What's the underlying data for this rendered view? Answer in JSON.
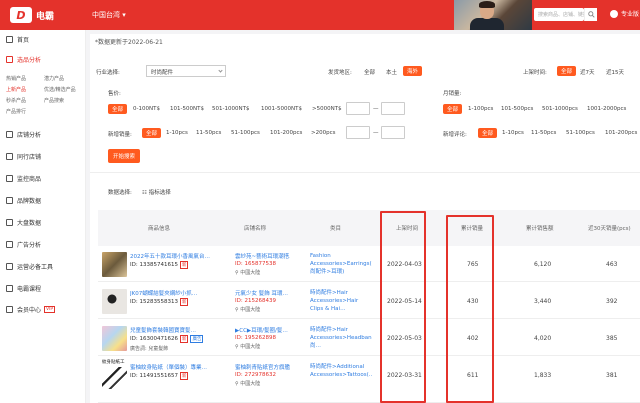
{
  "header": {
    "logo_mark": "D",
    "logo_text": "电霸",
    "region": "中国台湾 ▾",
    "search_placeholder": "搜索商品、店铺、链接",
    "user": "专业版"
  },
  "sidebar": {
    "items": [
      {
        "label": "首页"
      },
      {
        "label": "选品分析"
      },
      {
        "label": "店铺分析"
      },
      {
        "label": "同行店铺"
      },
      {
        "label": "监控商品"
      },
      {
        "label": "品牌数据"
      },
      {
        "label": "大盘数据"
      },
      {
        "label": "广告分析"
      },
      {
        "label": "运营必备工具"
      },
      {
        "label": "电霸课程"
      },
      {
        "label": "会员中心"
      }
    ],
    "sub_items": [
      "热销产品",
      "潜力产品",
      "上新产品",
      "优选/精选产品",
      "秒杀产品",
      "产品搜索",
      "产品排行"
    ],
    "member_badge": "VIP"
  },
  "main": {
    "update_note": "*数据更新于2022-06-21",
    "filters": {
      "category_label": "行业选择:",
      "category_value": "时尚配件",
      "origin_label": "发货地区:",
      "origin_options": [
        "全部",
        "本土",
        "海外"
      ],
      "launch_label": "上架时间:",
      "launch_options": [
        "全部",
        "近7天",
        "近15天"
      ],
      "price_label": "售价:",
      "price_options": [
        "全部",
        "0-100NT$",
        "101-500NT$",
        "501-1000NT$",
        "1001-5000NT$",
        ">5000NT$"
      ],
      "monthly_label": "月销量:",
      "monthly_options": [
        "全部",
        "1-100pcs",
        "101-500pcs",
        "501-1000pcs",
        "1001-2000pcs"
      ],
      "new_sales_label": "新增销量:",
      "new_sales_options": [
        "全部",
        "1-10pcs",
        "11-50pcs",
        "51-100pcs",
        "101-200pcs",
        ">200pcs"
      ],
      "new_reviews_label": "新增评论:",
      "new_reviews_options": [
        "全部",
        "1-10pcs",
        "11-50pcs",
        "51-100pcs",
        "101-200pcs"
      ],
      "dash": "—",
      "search_button": "开始搜索"
    },
    "data_select_label": "数据选择:",
    "metrics_select": "指标选择",
    "table": {
      "headers": [
        "商品信息",
        "店铺名称",
        "类目",
        "上架时间",
        "累计销量",
        "累计销售额",
        "近30天销量(pcs)"
      ],
      "rows": [
        {
          "title": "2022年五十款耳環小香風氣台…",
          "id": "ID: 13385741615",
          "tag": "新",
          "shop": "雲紗苑~藝術耳環潮搭…",
          "shop_id": "ID: 165877538",
          "location": "中國大陸",
          "category": "Fashion Accessories>Earrings(時尚配件>耳環)",
          "date": "2022-04-03",
          "sales": "765",
          "revenue": "6,120",
          "recent": "463"
        },
        {
          "title": "JK07蝴蝶結髮夾網紗小抓…",
          "id": "ID: 15283558313",
          "tag": "新",
          "shop": "元氣少女 髮飾 耳環…",
          "shop_id": "ID: 215268439",
          "location": "中國大陸",
          "category": "時尚配件>Hair Accessories>Hair Clips & Hai…",
          "date": "2022-05-14",
          "sales": "430",
          "revenue": "3,440",
          "recent": "392"
        },
        {
          "title": "兒童髮飾套裝韓國寶寶髮…",
          "id": "ID: 16300471626",
          "tag": "新",
          "tag2": "廣告",
          "extra": "廣告詞: 兒童髮飾",
          "shop": "▶CC▶耳環/髮圈/髮…",
          "shop_id": "ID: 195262898",
          "location": "中國大陸",
          "category": "時尚配件>Hair Accessories>Headbands(時尚…",
          "date": "2022-05-03",
          "sales": "402",
          "revenue": "4,020",
          "recent": "385"
        },
        {
          "title": "蜜柚紋身貼紙（單個裝）專業…",
          "id": "ID: 11491551657",
          "tag": "新",
          "thumb_caption": "紋身貼紙工",
          "shop": "蜜柚刺青貼紙官方旗艦…",
          "shop_id": "ID: 272978632",
          "location": "中國大陸",
          "category": "時尚配件>Additional Accessories>Tattoos(…",
          "date": "2022-03-31",
          "sales": "611",
          "revenue": "1,833",
          "recent": "381"
        }
      ]
    }
  },
  "colors": {
    "brand": "#e4322b",
    "accent": "#ff5a1f",
    "link": "#2f7de1"
  }
}
